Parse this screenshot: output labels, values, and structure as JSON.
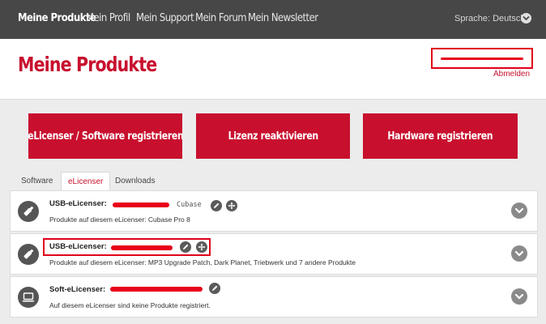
{
  "nav": {
    "items": [
      "Meine Produkte",
      "Mein Profil",
      "Mein Support",
      "Mein Forum",
      "Mein Newsletter"
    ],
    "language": "Sprache: Deutsch"
  },
  "header": {
    "title": "Meine Produkte",
    "logout": "Abmelden"
  },
  "actions": {
    "register_software": "eLicenser / Software registrieren",
    "reactivate": "Lizenz reaktivieren",
    "register_hardware": "Hardware registrieren"
  },
  "tabs": [
    "Software",
    "eLicenser",
    "Downloads"
  ],
  "active_tab": "eLicenser",
  "devices": [
    {
      "label": "USB-eLicenser:",
      "type": "Cubase",
      "products": "Produkte auf diesem eLicenser: Cubase Pro 8",
      "icon": "usb-stick-icon"
    },
    {
      "label": "USB-eLicenser:",
      "type": "",
      "products": "Produkte auf diesem eLicenser: MP3 Upgrade Patch, Dark Planet, Triebwerk und 7 andere Produkte",
      "icon": "usb-stick-icon"
    },
    {
      "label": "Soft-eLicenser:",
      "type": "",
      "products": "Auf diesem eLicenser sind keine Produkte registriert.",
      "icon": "laptop-icon"
    }
  ],
  "colors": {
    "brand_red": "#c8102e",
    "nav_bg": "#474747",
    "annotation_red": "#e0001a"
  }
}
